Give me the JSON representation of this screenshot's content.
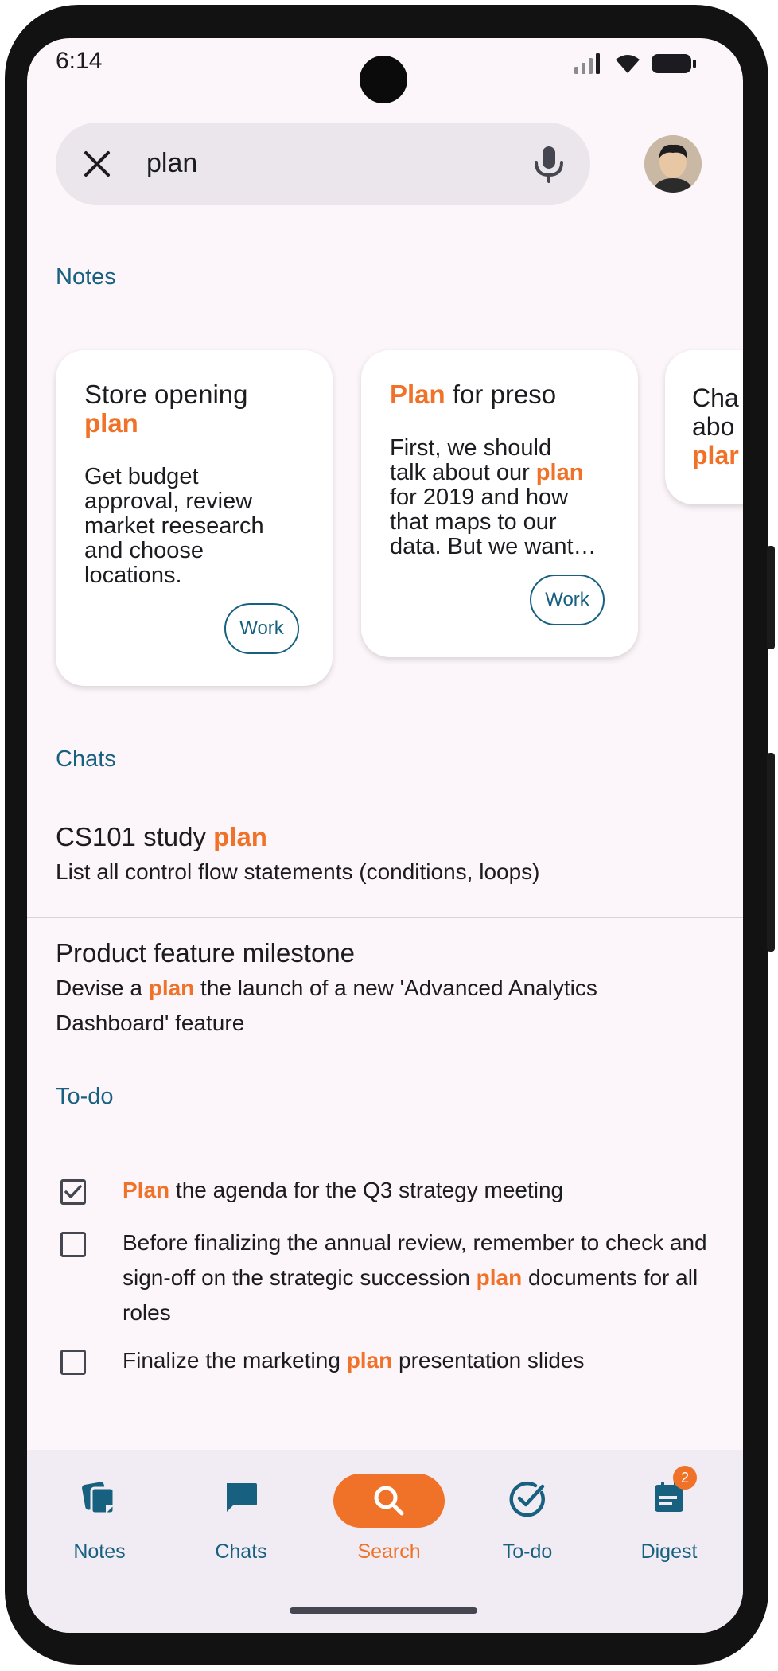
{
  "status_bar": {
    "time": "6:14"
  },
  "search": {
    "query": "plan"
  },
  "sections": {
    "notes": "Notes",
    "chats": "Chats",
    "todo": "To-do"
  },
  "notes": [
    {
      "title_pre": "Store opening",
      "title_hl": "plan",
      "title_post": "",
      "body_lines": [
        "Get budget",
        "approval, review",
        "market reesearch",
        "and choose",
        "locations."
      ],
      "label": "Work"
    },
    {
      "title_pre": "",
      "title_hl": "Plan",
      "title_post": " for preso",
      "body_line1": "First, we should",
      "body_line2_pre": "talk about our ",
      "body_line2_hl": "plan",
      "body_line3": "for 2019 and how",
      "body_line4": "that maps to our",
      "body_line5": "data. But we want…",
      "label": "Work"
    },
    {
      "partial_line1": "Cha",
      "partial_line2": "abo",
      "partial_line3": "plar"
    }
  ],
  "chats": [
    {
      "title_pre": "CS101 study ",
      "title_hl": "plan",
      "snippet": "List all control flow statements (conditions, loops)"
    },
    {
      "title": "Product feature milestone",
      "snippet_pre": "Devise a ",
      "snippet_hl": "plan",
      "snippet_post": " the launch of a new 'Advanced Analytics Dashboard' feature"
    }
  ],
  "todos": [
    {
      "checked": true,
      "hl_first": "Plan",
      "post": " the agenda for the Q3 strategy meeting"
    },
    {
      "checked": false,
      "pre": "Before finalizing the annual review, remember to check and sign-off on the strategic succession ",
      "hl": "plan",
      "post": " documents for all roles"
    },
    {
      "checked": false,
      "pre": "Finalize the marketing ",
      "hl": "plan",
      "post": " presentation slides"
    }
  ],
  "nav": {
    "items": [
      {
        "label": "Notes",
        "icon": "notes-icon"
      },
      {
        "label": "Chats",
        "icon": "chat-icon"
      },
      {
        "label": "Search",
        "icon": "search-icon",
        "active": true
      },
      {
        "label": "To-do",
        "icon": "check-circle-icon"
      },
      {
        "label": "Digest",
        "icon": "digest-icon",
        "badge": "2"
      }
    ]
  },
  "colors": {
    "accent": "#f07228",
    "primary": "#17607f",
    "background": "#fcf6fb"
  }
}
